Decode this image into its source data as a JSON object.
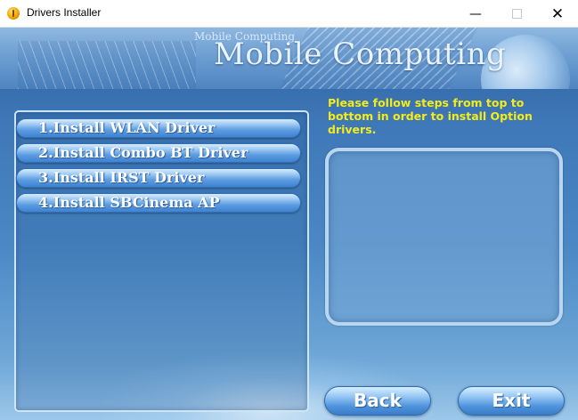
{
  "window": {
    "title": "Drivers Installer",
    "minimize_glyph": "—",
    "close_glyph": "✕"
  },
  "banner": {
    "small_text": "Mobile Computing",
    "title": "Mobile Computing"
  },
  "install_buttons": [
    {
      "label": "1.Install WLAN Driver"
    },
    {
      "label": "2.Install Combo BT Driver"
    },
    {
      "label": "3.Install IRST Driver"
    },
    {
      "label": "4.Install SBCinema AP"
    }
  ],
  "instructions": "Please follow steps from top to bottom in order to install Option drivers.",
  "nav": {
    "back_label": "Back",
    "exit_label": "Exit"
  },
  "colors": {
    "instruction_text": "#f2ec1a",
    "button_blue": "#3f82d2"
  }
}
